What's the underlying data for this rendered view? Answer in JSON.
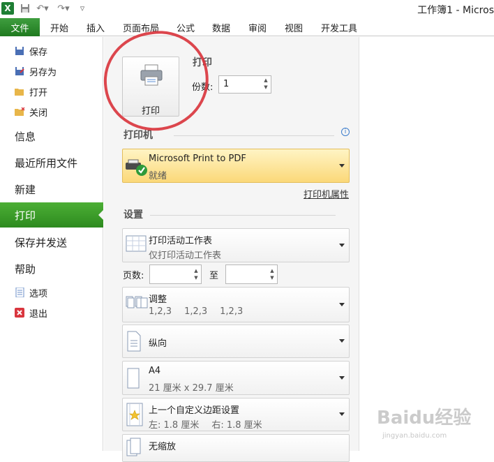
{
  "window": {
    "title": "工作簿1 - Micros"
  },
  "ribbon": {
    "file_tab": "文件",
    "tabs": [
      "开始",
      "插入",
      "页面布局",
      "公式",
      "数据",
      "审阅",
      "视图",
      "开发工具"
    ]
  },
  "nav": {
    "small_items": [
      "保存",
      "另存为",
      "打开",
      "关闭"
    ],
    "big_items": [
      "信息",
      "最近所用文件",
      "新建",
      "打印",
      "保存并发送",
      "帮助"
    ],
    "bottom_items": [
      "选项",
      "退出"
    ]
  },
  "print": {
    "heading": "打印",
    "print_button_label": "打印",
    "copies_label": "份数:",
    "copies_value": "1"
  },
  "printer": {
    "heading": "打印机",
    "name": "Microsoft Print to PDF",
    "status": "就绪",
    "properties_link": "打印机属性"
  },
  "settings": {
    "heading": "设置",
    "what_to_print": {
      "title": "打印活动工作表",
      "subtitle": "仅打印活动工作表"
    },
    "pages_label": "页数:",
    "to_label": "至",
    "collate": {
      "title": "调整",
      "subtitles": [
        "1,2,3",
        "1,2,3",
        "1,2,3"
      ]
    },
    "orientation": {
      "title": "纵向"
    },
    "paper": {
      "title": "A4",
      "subtitle": "21 厘米 x 29.7 厘米"
    },
    "margins": {
      "title": "上一个自定义边距设置",
      "left": "左:  1.8 厘米",
      "right": "右:  1.8 厘米"
    },
    "scaling": {
      "title": "无缩放"
    }
  },
  "watermark": {
    "text": "Baidu经验",
    "url_text": "jingyan.baidu.com"
  },
  "colors": {
    "accent_green": "#2d8a1f",
    "printer_highlight": "#fbd879",
    "annotation_red": "#d9363e"
  }
}
